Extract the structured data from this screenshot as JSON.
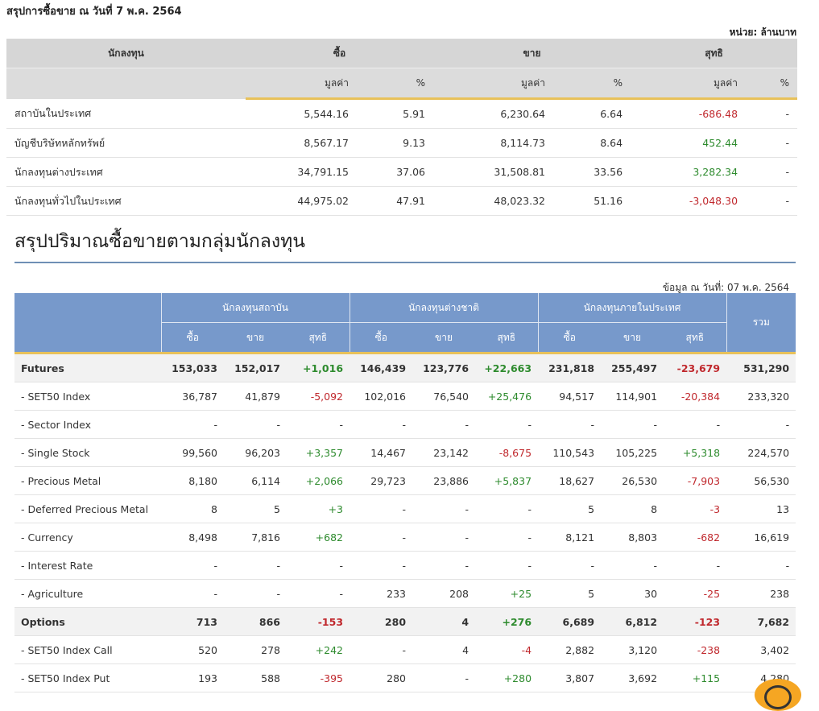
{
  "summary": {
    "title": "สรุปการซื้อขาย ณ วันที่ 7 พ.ค. 2564",
    "unit": "หน่วย: ล้านบาท",
    "headers": {
      "investor": "นักลงทุน",
      "buy": "ซื้อ",
      "sell": "ขาย",
      "net": "สุทธิ",
      "value": "มูลค่า",
      "pct": "%"
    },
    "rows": [
      {
        "name": "สถาบันในประเทศ",
        "buy": "5,544.16",
        "buy_pct": "5.91",
        "sell": "6,230.64",
        "sell_pct": "6.64",
        "net": "-686.48",
        "net_pct": "-"
      },
      {
        "name": "บัญชีบริษัทหลักทรัพย์",
        "buy": "8,567.17",
        "buy_pct": "9.13",
        "sell": "8,114.73",
        "sell_pct": "8.64",
        "net": "452.44",
        "net_pct": "-"
      },
      {
        "name": "นักลงทุนต่างประเทศ",
        "buy": "34,791.15",
        "buy_pct": "37.06",
        "sell": "31,508.81",
        "sell_pct": "33.56",
        "net": "3,282.34",
        "net_pct": "-"
      },
      {
        "name": "นักลงทุนทั่วไปในประเทศ",
        "buy": "44,975.02",
        "buy_pct": "47.91",
        "sell": "48,023.32",
        "sell_pct": "51.16",
        "net": "-3,048.30",
        "net_pct": "-"
      }
    ]
  },
  "groups": {
    "title": "สรุปปริมาณซื้อขายตามกลุ่มนักลงทุน",
    "as_of": "ข้อมูล ณ วันที่: 07 พ.ค. 2564",
    "headers": {
      "institutional": "นักลงทุนสถาบัน",
      "foreign": "นักลงทุนต่างชาติ",
      "local": "นักลงทุนภายในประเทศ",
      "total": "รวม",
      "buy": "ซื้อ",
      "sell": "ขาย",
      "net": "สุทธิ"
    },
    "rows": [
      {
        "name": "Futures",
        "bold": true,
        "v": [
          "153,033",
          "152,017",
          "+1,016",
          "146,439",
          "123,776",
          "+22,663",
          "231,818",
          "255,497",
          "-23,679",
          "531,290"
        ]
      },
      {
        "name": "- SET50 Index",
        "v": [
          "36,787",
          "41,879",
          "-5,092",
          "102,016",
          "76,540",
          "+25,476",
          "94,517",
          "114,901",
          "-20,384",
          "233,320"
        ]
      },
      {
        "name": "- Sector Index",
        "v": [
          "-",
          "-",
          "-",
          "-",
          "-",
          "-",
          "-",
          "-",
          "-",
          "-"
        ]
      },
      {
        "name": "- Single Stock",
        "v": [
          "99,560",
          "96,203",
          "+3,357",
          "14,467",
          "23,142",
          "-8,675",
          "110,543",
          "105,225",
          "+5,318",
          "224,570"
        ]
      },
      {
        "name": "- Precious Metal",
        "v": [
          "8,180",
          "6,114",
          "+2,066",
          "29,723",
          "23,886",
          "+5,837",
          "18,627",
          "26,530",
          "-7,903",
          "56,530"
        ]
      },
      {
        "name": "- Deferred Precious Metal",
        "v": [
          "8",
          "5",
          "+3",
          "-",
          "-",
          "-",
          "5",
          "8",
          "-3",
          "13"
        ]
      },
      {
        "name": "- Currency",
        "v": [
          "8,498",
          "7,816",
          "+682",
          "-",
          "-",
          "-",
          "8,121",
          "8,803",
          "-682",
          "16,619"
        ]
      },
      {
        "name": "- Interest Rate",
        "v": [
          "-",
          "-",
          "-",
          "-",
          "-",
          "-",
          "-",
          "-",
          "-",
          "-"
        ]
      },
      {
        "name": "- Agriculture",
        "v": [
          "-",
          "-",
          "-",
          "233",
          "208",
          "+25",
          "5",
          "30",
          "-25",
          "238"
        ]
      },
      {
        "name": "Options",
        "bold": true,
        "v": [
          "713",
          "866",
          "-153",
          "280",
          "4",
          "+276",
          "6,689",
          "6,812",
          "-123",
          "7,682"
        ]
      },
      {
        "name": "- SET50 Index Call",
        "v": [
          "520",
          "278",
          "+242",
          "-",
          "4",
          "-4",
          "2,882",
          "3,120",
          "-238",
          "3,402"
        ]
      },
      {
        "name": "- SET50 Index Put",
        "v": [
          "193",
          "588",
          "-395",
          "280",
          "-",
          "+280",
          "3,807",
          "3,692",
          "+115",
          "4,280"
        ]
      }
    ]
  }
}
